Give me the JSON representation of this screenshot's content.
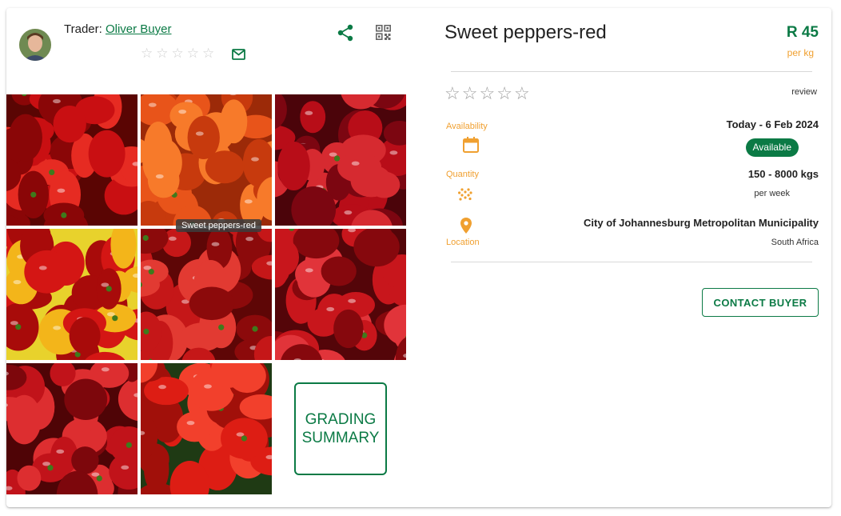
{
  "trader": {
    "label": "Trader: ",
    "name": "Oliver Buyer",
    "rating_stars": [
      "☆",
      "☆",
      "☆",
      "☆",
      "☆"
    ]
  },
  "gallery": {
    "tooltip": "Sweet peppers-red",
    "grading_summary": "GRADING SUMMARY",
    "tiles": [
      {
        "palette": [
          "#c90f12",
          "#8a0607",
          "#e62b22",
          "#5a0503"
        ]
      },
      {
        "palette": [
          "#e8541a",
          "#c73a0d",
          "#f77a2a",
          "#9c2a08"
        ]
      },
      {
        "palette": [
          "#b80d18",
          "#7c0611",
          "#d62a30",
          "#4b040a"
        ]
      },
      {
        "palette": [
          "#d41614",
          "#f3b51a",
          "#a80b0a",
          "#e8d22c"
        ]
      },
      {
        "palette": [
          "#c51718",
          "#8c0a0b",
          "#e23a32",
          "#5e0606"
        ]
      },
      {
        "palette": [
          "#c8161c",
          "#86080d",
          "#e1343a",
          "#540509"
        ]
      },
      {
        "palette": [
          "#c1131a",
          "#7d070c",
          "#dd2e30",
          "#4f0406"
        ]
      },
      {
        "palette": [
          "#dd1d14",
          "#a1100a",
          "#f2402c",
          "#1f3a14"
        ]
      }
    ]
  },
  "product": {
    "title": "Sweet peppers-red",
    "price": "R 45",
    "price_unit": "per kg",
    "review_stars": [
      "☆",
      "☆",
      "☆",
      "☆",
      "☆"
    ],
    "review_label": "review"
  },
  "availability": {
    "label": "Availability",
    "date": "Today - 6 Feb 2024",
    "status": "Available"
  },
  "quantity": {
    "label": "Quantity",
    "range": "150 - 8000 kgs",
    "period": "per week"
  },
  "location": {
    "label": "Location",
    "city": "City of Johannesburg Metropolitan Municipality",
    "country": "South Africa"
  },
  "actions": {
    "contact": "CONTACT BUYER"
  },
  "colors": {
    "brand": "#0b7a45",
    "accent": "#f0a030"
  }
}
